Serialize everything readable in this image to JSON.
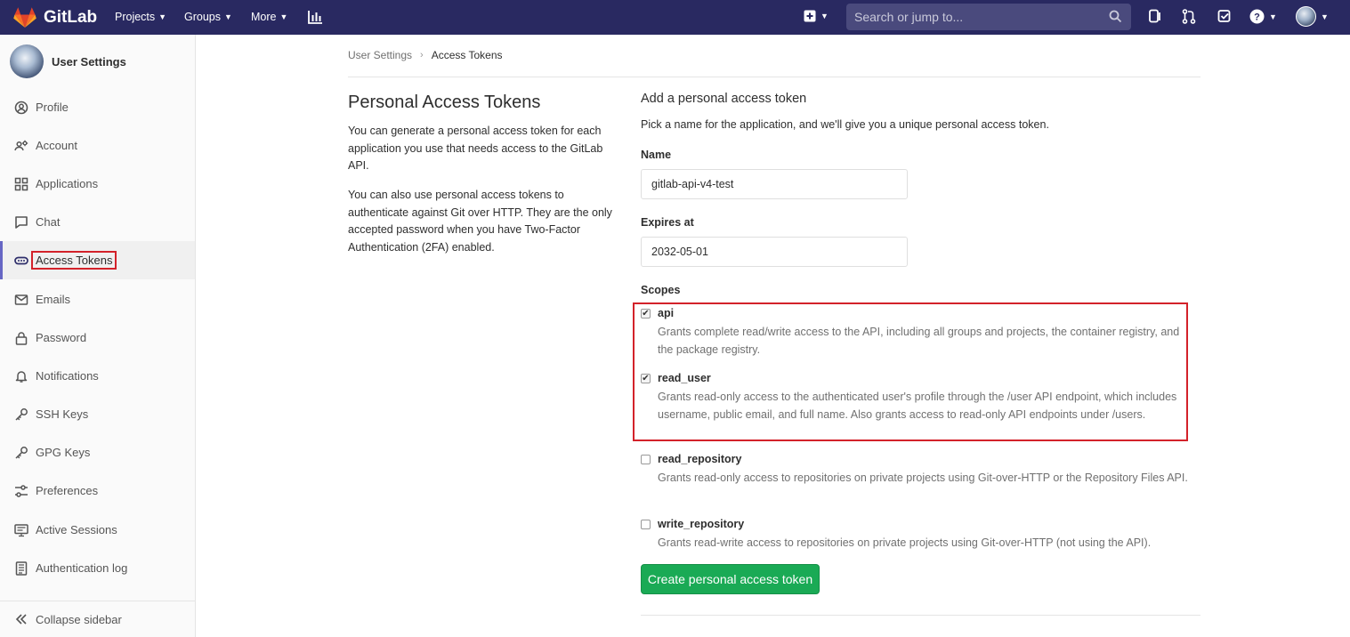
{
  "navbar": {
    "brand": "GitLab",
    "projects": "Projects",
    "groups": "Groups",
    "more": "More",
    "search_placeholder": "Search or jump to..."
  },
  "sidebar": {
    "title": "User Settings",
    "items": [
      {
        "label": "Profile",
        "icon": "profile-icon"
      },
      {
        "label": "Account",
        "icon": "account-icon"
      },
      {
        "label": "Applications",
        "icon": "applications-icon"
      },
      {
        "label": "Chat",
        "icon": "chat-icon"
      },
      {
        "label": "Access Tokens",
        "icon": "token-icon",
        "active": true
      },
      {
        "label": "Emails",
        "icon": "mail-icon"
      },
      {
        "label": "Password",
        "icon": "lock-icon"
      },
      {
        "label": "Notifications",
        "icon": "bell-icon"
      },
      {
        "label": "SSH Keys",
        "icon": "key-icon"
      },
      {
        "label": "GPG Keys",
        "icon": "key-icon"
      },
      {
        "label": "Preferences",
        "icon": "sliders-icon"
      },
      {
        "label": "Active Sessions",
        "icon": "monitor-icon"
      },
      {
        "label": "Authentication log",
        "icon": "log-icon"
      }
    ],
    "collapse": "Collapse sidebar"
  },
  "breadcrumb": {
    "parent": "User Settings",
    "current": "Access Tokens"
  },
  "left": {
    "title": "Personal Access Tokens",
    "p1": "You can generate a personal access token for each application you use that needs access to the GitLab API.",
    "p2": "You can also use personal access tokens to authenticate against Git over HTTP. They are the only accepted password when you have Two-Factor Authentication (2FA) enabled."
  },
  "form": {
    "title": "Add a personal access token",
    "description": "Pick a name for the application, and we'll give you a unique personal access token.",
    "name_label": "Name",
    "name_value": "gitlab-api-v4-test",
    "expires_label": "Expires at",
    "expires_value": "2032-05-01",
    "scopes_label": "Scopes",
    "scopes": [
      {
        "name": "api",
        "checked": true,
        "desc": "Grants complete read/write access to the API, including all groups and projects, the container registry, and the package registry."
      },
      {
        "name": "read_user",
        "checked": true,
        "desc": "Grants read-only access to the authenticated user's profile through the /user API endpoint, which includes username, public email, and full name. Also grants access to read-only API endpoints under /users."
      },
      {
        "name": "read_repository",
        "checked": false,
        "desc": "Grants read-only access to repositories on private projects using Git-over-HTTP or the Repository Files API."
      },
      {
        "name": "write_repository",
        "checked": false,
        "desc": "Grants read-write access to repositories on private projects using Git-over-HTTP (not using the API)."
      }
    ],
    "submit": "Create personal access token"
  },
  "colors": {
    "navbar": "#292961",
    "accent_green": "#1aaa55",
    "highlight_red": "#d3222a",
    "active_border": "#6666c4"
  }
}
